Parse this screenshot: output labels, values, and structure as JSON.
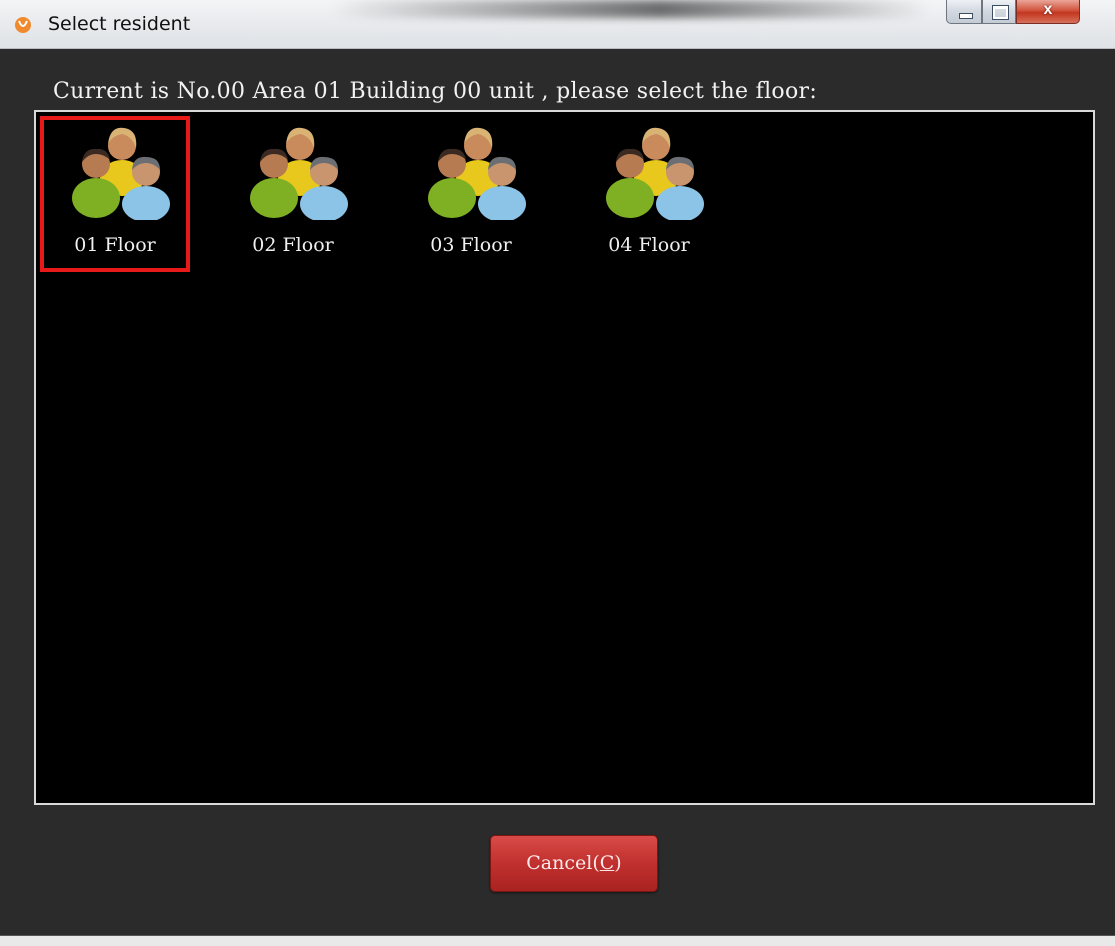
{
  "window": {
    "title": "Select resident",
    "controls": {
      "minimize_icon": "minimize-icon",
      "maximize_icon": "maximize-icon",
      "close_label": "x"
    }
  },
  "prompt": "Current is No.00 Area 01 Building 00 unit , please select the floor:",
  "floors": [
    {
      "label": "01 Floor",
      "icon": "residents-group-icon",
      "selected": true
    },
    {
      "label": "02 Floor",
      "icon": "residents-group-icon",
      "selected": false
    },
    {
      "label": "03 Floor",
      "icon": "residents-group-icon",
      "selected": false
    },
    {
      "label": "04 Floor",
      "icon": "residents-group-icon",
      "selected": false
    }
  ],
  "cancel_button": {
    "label_prefix": "Cancel(",
    "mnemonic": "C",
    "label_suffix": ")"
  },
  "colors": {
    "selection_border": "#e81919",
    "cancel_button": "#c0302e",
    "panel_background": "#000000",
    "dialog_background": "#2b2b2b"
  }
}
